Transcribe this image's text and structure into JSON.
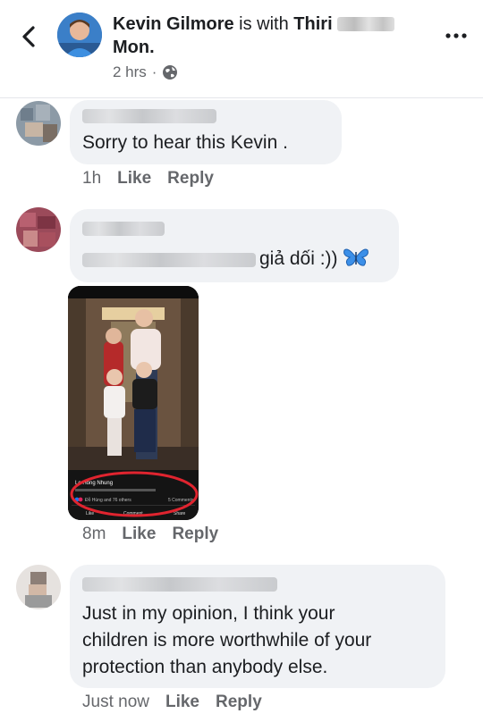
{
  "header": {
    "author": "Kevin Gilmore",
    "with_text": " is with ",
    "tagged_first": "Thiri",
    "tagged_last": "Mon.",
    "time": "2 hrs",
    "separator": "·"
  },
  "comments": [
    {
      "text": "Sorry to hear this Kevin .",
      "time": "1h",
      "like": "Like",
      "reply": "Reply"
    },
    {
      "text": "giả dối :))",
      "emoji": "butterfly-emoji",
      "time": "8m",
      "like": "Like",
      "reply": "Reply",
      "attachment": {
        "poster": "Le Hong Nhung",
        "reactions": "Đỗ Hùng and 76 others",
        "comments": "5 Comments",
        "like": "Like",
        "comment": "Comment",
        "share": "Share"
      }
    },
    {
      "text_lines": [
        "Just in my opinion, I think your",
        "children is more worthwhile of your",
        "protection  than anybody else."
      ],
      "time": "Just now",
      "like": "Like",
      "reply": "Reply"
    }
  ],
  "colors": {
    "accent": "#1877f2",
    "bubble": "#f0f2f5",
    "secondary_text": "#65676b",
    "highlight_circle": "#e0242f"
  }
}
